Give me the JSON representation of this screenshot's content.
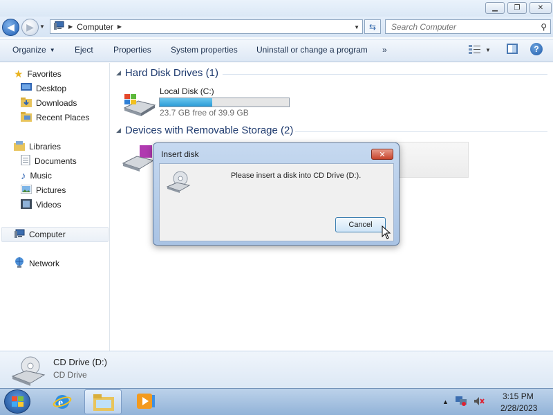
{
  "window": {
    "address": {
      "crumb": "Computer"
    },
    "search": {
      "placeholder": "Search Computer"
    }
  },
  "toolbar": {
    "organize": "Organize",
    "eject": "Eject",
    "properties": "Properties",
    "system_properties": "System properties",
    "uninstall": "Uninstall or change a program",
    "more": "»"
  },
  "nav": {
    "favorites": "Favorites",
    "desktop": "Desktop",
    "downloads": "Downloads",
    "recent_places": "Recent Places",
    "libraries": "Libraries",
    "documents": "Documents",
    "music": "Music",
    "pictures": "Pictures",
    "videos": "Videos",
    "computer": "Computer",
    "network": "Network"
  },
  "content": {
    "hdd_group": "Hard Disk Drives (1)",
    "removable_group": "Devices with Removable Storage (2)",
    "drive_c": {
      "name": "Local Disk (C:)",
      "free_text": "23.7 GB free of 39.9 GB",
      "used_fraction": 0.406
    }
  },
  "dialog": {
    "title": "Insert disk",
    "close": "✕",
    "message": "Please insert a disk into CD Drive (D:).",
    "cancel": "Cancel"
  },
  "details": {
    "name": "CD Drive (D:)",
    "type": "CD Drive"
  },
  "taskbar": {
    "time": "3:15 PM",
    "date": "2/28/2023"
  },
  "colors": {
    "accent": "#1e5aa8",
    "progress": "#2b9bd6",
    "close_red": "#c7432b"
  }
}
